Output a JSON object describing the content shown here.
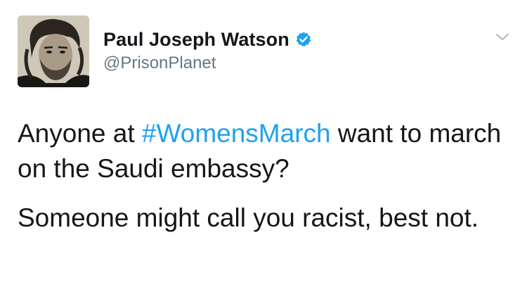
{
  "author": {
    "display_name": "Paul Joseph Watson",
    "handle": "@PrisonPlanet",
    "verified": true,
    "verified_color": "#1da1f2"
  },
  "tweet": {
    "para1_before": "Anyone at ",
    "hashtag": "#WomensMarch",
    "para1_after": " want to march on the Saudi embassy?",
    "para2": "Someone might call you racist, best not.",
    "hashtag_color": "#1da1f2"
  },
  "icons": {
    "menu": "chevron-down-icon",
    "verified": "verified-badge-icon",
    "avatar": "user-avatar"
  }
}
